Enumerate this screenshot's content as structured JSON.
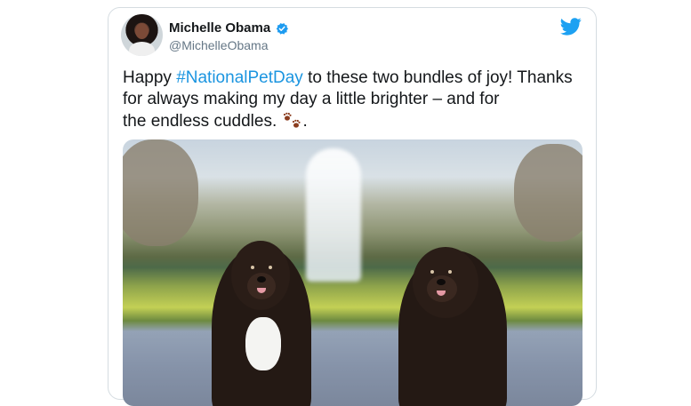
{
  "tweet": {
    "author_name": "Michelle Obama",
    "handle": "@MichelleObama",
    "text_before": "Happy ",
    "hashtag": "#NationalPetDay",
    "text_line1_after": " to these two bundles of joy! Thanks",
    "text_line2": "for always making my day a little brighter – and for",
    "text_line3": "the endless cuddles.",
    "text_end": ".",
    "icons": [
      "avatar",
      "verified-badge-icon",
      "twitter-bird-icon",
      "paw-prints-icon"
    ],
    "colors": {
      "accent": "#1b95e0",
      "text": "#14171a",
      "muted": "#657786",
      "border": "#d5dce1"
    }
  }
}
